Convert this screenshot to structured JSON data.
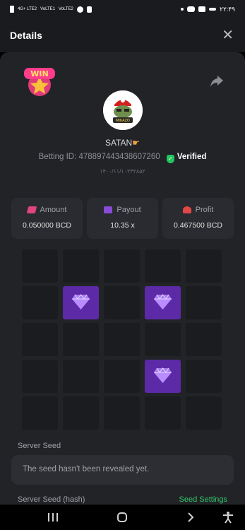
{
  "status_bar": {
    "time": "۲۲:۴۹",
    "left_labels": [
      "4G+ LTE2",
      "VoLTE1",
      "VoLTE2"
    ]
  },
  "header": {
    "title": "Details",
    "close_icon": "close-icon"
  },
  "user": {
    "name": "SATAN",
    "avatar_label": "MIKAZO",
    "betting_id_label": "Betting ID:",
    "betting_id": "478897443438607260",
    "verified_label": "Verified",
    "date": "۱۴۰۰/۱۱/۱۰۲۳۲۸۵۲"
  },
  "badge": {
    "text": "WIN"
  },
  "stats": [
    {
      "label": "Amount",
      "value": "0.050000 BCD",
      "icon": "coins-icon"
    },
    {
      "label": "Payout",
      "value": "10.35 x",
      "icon": "wallet-icon"
    },
    {
      "label": "Profit",
      "value": "0.467500 BCD",
      "icon": "profit-icon"
    }
  ],
  "board": {
    "rows": 5,
    "cols": 5,
    "gems": [
      [
        1,
        1
      ],
      [
        1,
        3
      ],
      [
        3,
        3
      ]
    ]
  },
  "server_seed": {
    "label": "Server Seed",
    "message": "The seed hasn't been revealed yet.",
    "hash_label": "Server Seed (hash)",
    "settings_link": "Seed Settings"
  },
  "colors": {
    "accent": "#31c46a",
    "gem_tile": "#5c2aa7",
    "panel": "#222327"
  }
}
